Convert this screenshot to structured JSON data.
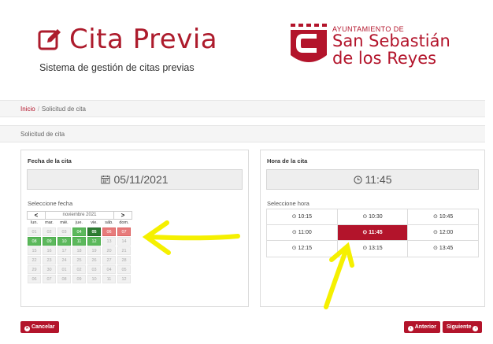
{
  "header": {
    "title": "Cita Previa",
    "subtitle": "Sistema de gestión de citas previas",
    "logo": {
      "line1": "AYUNTAMIENTO DE",
      "line2": "San Sebastián",
      "line3": "de los Reyes"
    }
  },
  "breadcrumb": {
    "home": "Inicio",
    "separator": "/",
    "current": "Solicitud de cita"
  },
  "section_title": "Solicitud de cita",
  "date_panel": {
    "title": "Fecha de la cita",
    "selected_date": "05/11/2021",
    "select_label": "Seleccione fecha",
    "calendar": {
      "prev": "<",
      "next": ">",
      "month": "noviembre 2021",
      "weekdays": [
        "lun.",
        "mar.",
        "mié.",
        "jue.",
        "vie.",
        "sáb.",
        "dom."
      ],
      "weeks": [
        [
          {
            "d": "01",
            "s": "off"
          },
          {
            "d": "02",
            "s": "off"
          },
          {
            "d": "03",
            "s": "off"
          },
          {
            "d": "04",
            "s": "avail"
          },
          {
            "d": "05",
            "s": "sel"
          },
          {
            "d": "06",
            "s": "full"
          },
          {
            "d": "07",
            "s": "full"
          }
        ],
        [
          {
            "d": "08",
            "s": "avail"
          },
          {
            "d": "09",
            "s": "avail"
          },
          {
            "d": "10",
            "s": "avail"
          },
          {
            "d": "11",
            "s": "avail"
          },
          {
            "d": "12",
            "s": "avail"
          },
          {
            "d": "13",
            "s": "off"
          },
          {
            "d": "14",
            "s": "off"
          }
        ],
        [
          {
            "d": "15",
            "s": "off"
          },
          {
            "d": "16",
            "s": "off"
          },
          {
            "d": "17",
            "s": "off"
          },
          {
            "d": "18",
            "s": "off"
          },
          {
            "d": "19",
            "s": "off"
          },
          {
            "d": "20",
            "s": "off"
          },
          {
            "d": "21",
            "s": "off"
          }
        ],
        [
          {
            "d": "22",
            "s": "off"
          },
          {
            "d": "23",
            "s": "off"
          },
          {
            "d": "24",
            "s": "off"
          },
          {
            "d": "25",
            "s": "off"
          },
          {
            "d": "26",
            "s": "off"
          },
          {
            "d": "27",
            "s": "off"
          },
          {
            "d": "28",
            "s": "off"
          }
        ],
        [
          {
            "d": "29",
            "s": "off"
          },
          {
            "d": "30",
            "s": "off"
          },
          {
            "d": "01",
            "s": "off"
          },
          {
            "d": "02",
            "s": "off"
          },
          {
            "d": "03",
            "s": "off"
          },
          {
            "d": "04",
            "s": "off"
          },
          {
            "d": "05",
            "s": "off"
          }
        ],
        [
          {
            "d": "06",
            "s": "off"
          },
          {
            "d": "07",
            "s": "off"
          },
          {
            "d": "08",
            "s": "off"
          },
          {
            "d": "09",
            "s": "off"
          },
          {
            "d": "10",
            "s": "off"
          },
          {
            "d": "11",
            "s": "off"
          },
          {
            "d": "12",
            "s": "off"
          }
        ]
      ]
    }
  },
  "time_panel": {
    "title": "Hora de la cita",
    "selected_time": "11:45",
    "select_label": "Seleccione hora",
    "slots": [
      [
        {
          "t": "10:15",
          "active": false
        },
        {
          "t": "10:30",
          "active": false
        },
        {
          "t": "10:45",
          "active": false
        }
      ],
      [
        {
          "t": "11:00",
          "active": false
        },
        {
          "t": "11:45",
          "active": true
        },
        {
          "t": "12:00",
          "active": false
        }
      ],
      [
        {
          "t": "12:15",
          "active": false
        },
        {
          "t": "13:15",
          "active": false
        },
        {
          "t": "13:45",
          "active": false
        }
      ]
    ]
  },
  "buttons": {
    "cancel": "Cancelar",
    "previous": "Anterior",
    "next": "Siguiente"
  },
  "icons": {
    "edit": "edit-icon",
    "calendar": "calendar-icon",
    "clock": "clock-icon"
  },
  "colors": {
    "brand": "#b3142b",
    "available": "#5cb85c",
    "selected_day": "#2e7d32",
    "full": "#e77b7b",
    "annotation": "#f5f000"
  }
}
